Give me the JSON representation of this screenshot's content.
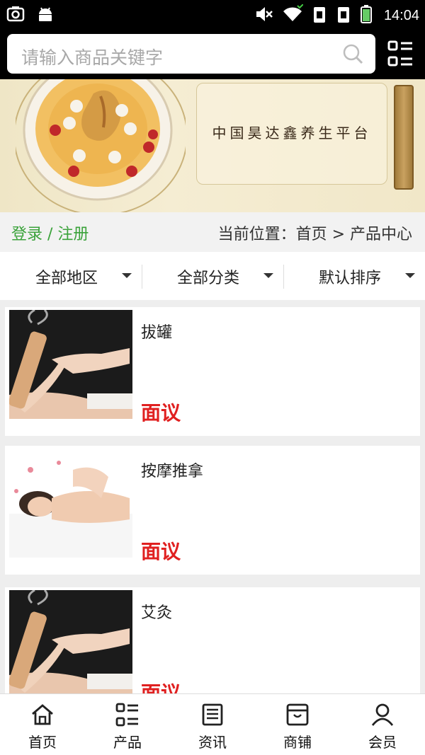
{
  "status_bar": {
    "time": "14:04",
    "left_icons": [
      "screenshot-icon",
      "android-icon"
    ],
    "right_icons": [
      "mute-icon",
      "wifi-icon",
      "sim1-icon",
      "sim2-icon",
      "battery-icon"
    ]
  },
  "search": {
    "placeholder": "请输入商品关键字",
    "search_icon": "search-icon",
    "menu_icon": "grid-menu-icon"
  },
  "banner": {
    "slogan": "中国昊达鑫养生平台"
  },
  "crumb": {
    "login_label": "登录 / 注册",
    "location_label": "当前位置：首页 > 产品中心"
  },
  "filters": [
    {
      "label": "全部地区"
    },
    {
      "label": "全部分类"
    },
    {
      "label": "默认排序"
    }
  ],
  "products": [
    {
      "title": "拔罐",
      "price": "面议",
      "image": "moxibustion-photo"
    },
    {
      "title": "按摩推拿",
      "price": "面议",
      "image": "massage-photo"
    },
    {
      "title": "艾灸",
      "price": "面议",
      "image": "moxibustion-photo"
    }
  ],
  "bottom_nav": [
    {
      "label": "首页",
      "icon": "home-icon"
    },
    {
      "label": "产品",
      "icon": "product-list-icon"
    },
    {
      "label": "资讯",
      "icon": "news-icon"
    },
    {
      "label": "商铺",
      "icon": "shop-icon"
    },
    {
      "label": "会员",
      "icon": "user-icon"
    }
  ],
  "colors": {
    "accent_green": "#3aa23a",
    "price_red": "#e02020",
    "header_bg": "#000000"
  }
}
